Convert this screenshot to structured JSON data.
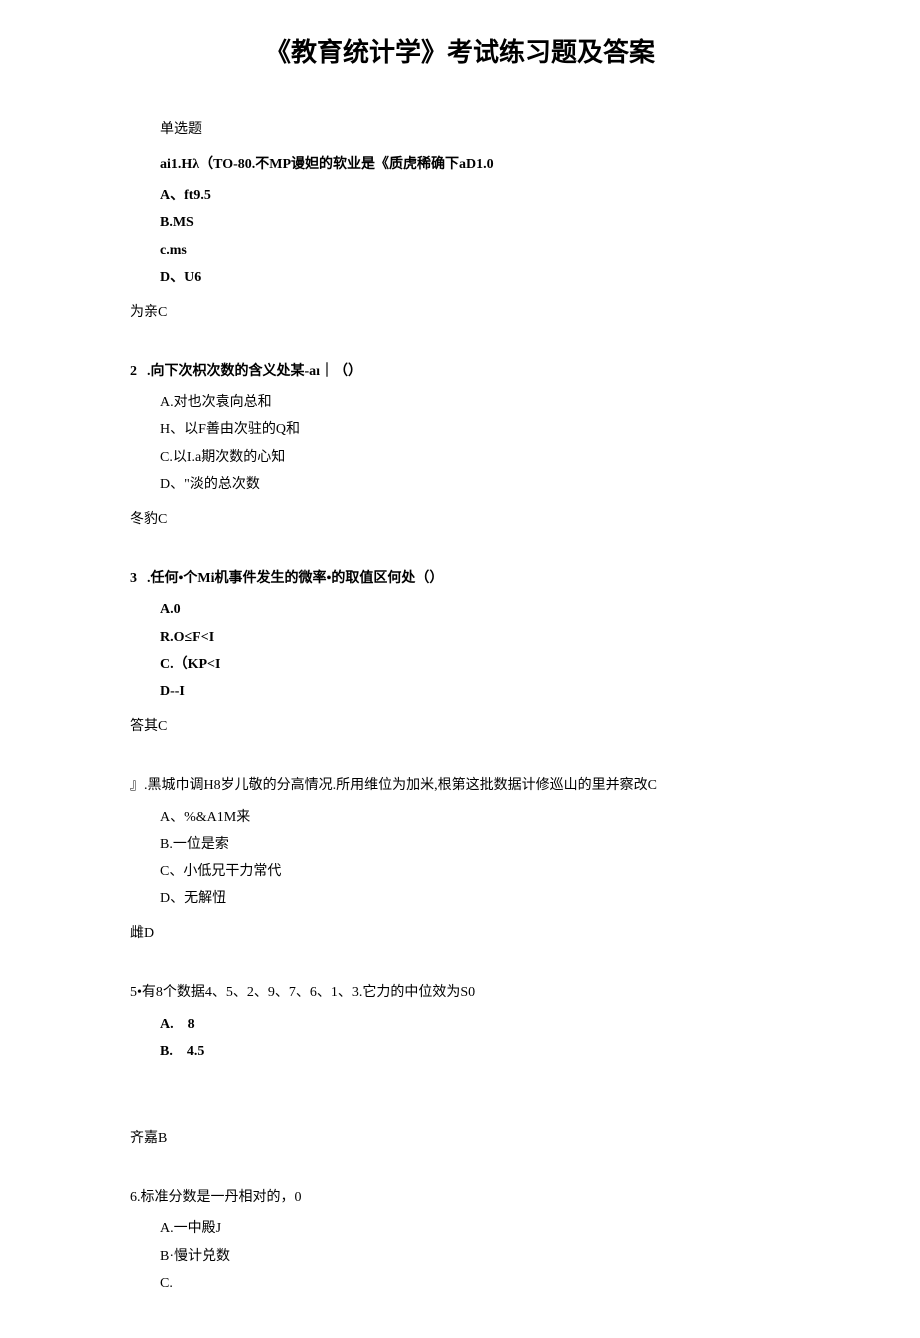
{
  "title": "《教育统计学》考试练习题及答案",
  "section_label": "单选题",
  "q1": {
    "stem": "ai1.Hλ（TO-80.不MP谩妲的软业是《质虎稀确下aD1.0",
    "a": "A、ft9.5",
    "b": "B.MS",
    "c": "c.ms",
    "d": "D、U6",
    "answer": "为亲C"
  },
  "q2": {
    "num": "2",
    "stem": ".向下次枳次数的含义处某-aı｜（）",
    "a": "A.对也次袁向总和",
    "b": "H、以F善由次驻的Q和",
    "c": "C.以I.a期次数的心知",
    "d": "D、\"淡的总次数",
    "answer": "冬豹C"
  },
  "q3": {
    "num": "3",
    "stem": ".任何•个Mi机事件发生的微率•的取值区何处（）",
    "a": "A.0",
    "b": "R.O≤F<I",
    "c": "C.（KP<I",
    "d": "D--I",
    "answer": "答其C"
  },
  "q4": {
    "stem": "』.黑城巾调H8岁儿敬的分高情况.所用维位为加米,根第这批数据计修巡山的里并察改C",
    "a": "A、%&A1M来",
    "b": "B.一位是索",
    "c": "C、小低兄干力常代",
    "d": "D、无解忸",
    "answer": "雌D"
  },
  "q5": {
    "stem": "5•有8个数据4、5、2、9、7、6、1、3.它力的中位效为S0",
    "a": "A.　8",
    "b": "B.　4.5",
    "answer": "齐嘉B"
  },
  "q6": {
    "stem": "6.标准分数是一丹相对的，0",
    "a": "A.一中殿J",
    "b": "B·慢计兑数",
    "c": "C."
  }
}
